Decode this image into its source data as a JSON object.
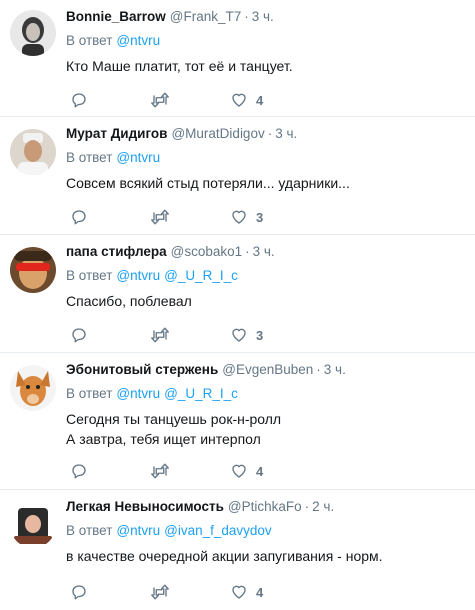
{
  "tweets": [
    {
      "name": "Bonnie_Barrow",
      "handle": "@Frank_T7",
      "dot": "·",
      "time": "3 ч.",
      "reply_prefix": "В ответ",
      "mentions": [
        "@ntvru"
      ],
      "lines": [
        "Кто Маше платит, тот её и танцует."
      ],
      "likes": "4",
      "avatar_icon": "woman-portrait-avatar"
    },
    {
      "name": "Мурат Дидигов",
      "handle": "@MuratDidigov",
      "dot": "·",
      "time": "3 ч.",
      "reply_prefix": "В ответ",
      "mentions": [
        "@ntvru"
      ],
      "lines": [
        "Совсем всякий стыд потеряли... ударники..."
      ],
      "likes": "3",
      "avatar_icon": "man-portrait-avatar"
    },
    {
      "name": "папа стифлера",
      "handle": "@scobako1",
      "dot": "·",
      "time": "3 ч.",
      "reply_prefix": "В ответ",
      "mentions": [
        "@ntvru",
        "@_U_R_I_c"
      ],
      "lines": [
        "Спасибо, поблевал"
      ],
      "likes": "3",
      "avatar_icon": "red-sunglasses-avatar"
    },
    {
      "name": "Эбонитовый стержень",
      "handle": "@EvgenBuben",
      "dot": "·",
      "time": "3 ч.",
      "reply_prefix": "В ответ",
      "mentions": [
        "@ntvru",
        "@_U_R_I_c"
      ],
      "lines": [
        "Сегодня ты танцуешь рок-н-ролл",
        "А завтра, тебя ищет интерпол"
      ],
      "likes": "4",
      "avatar_icon": "dog-mask-avatar"
    },
    {
      "name": "Легкая Невыносимость",
      "handle": "@PtichkaFo",
      "dot": "·",
      "time": "2 ч.",
      "reply_prefix": "В ответ",
      "mentions": [
        "@ntvru",
        "@ivan_f_davydov"
      ],
      "lines": [
        "в качестве очередной акции запугивания - норм."
      ],
      "likes": "4",
      "avatar_icon": "cartoon-avatar"
    }
  ],
  "colors": {
    "link": "#1da1f2",
    "muted": "#657786",
    "divider": "#e6ecf0"
  }
}
